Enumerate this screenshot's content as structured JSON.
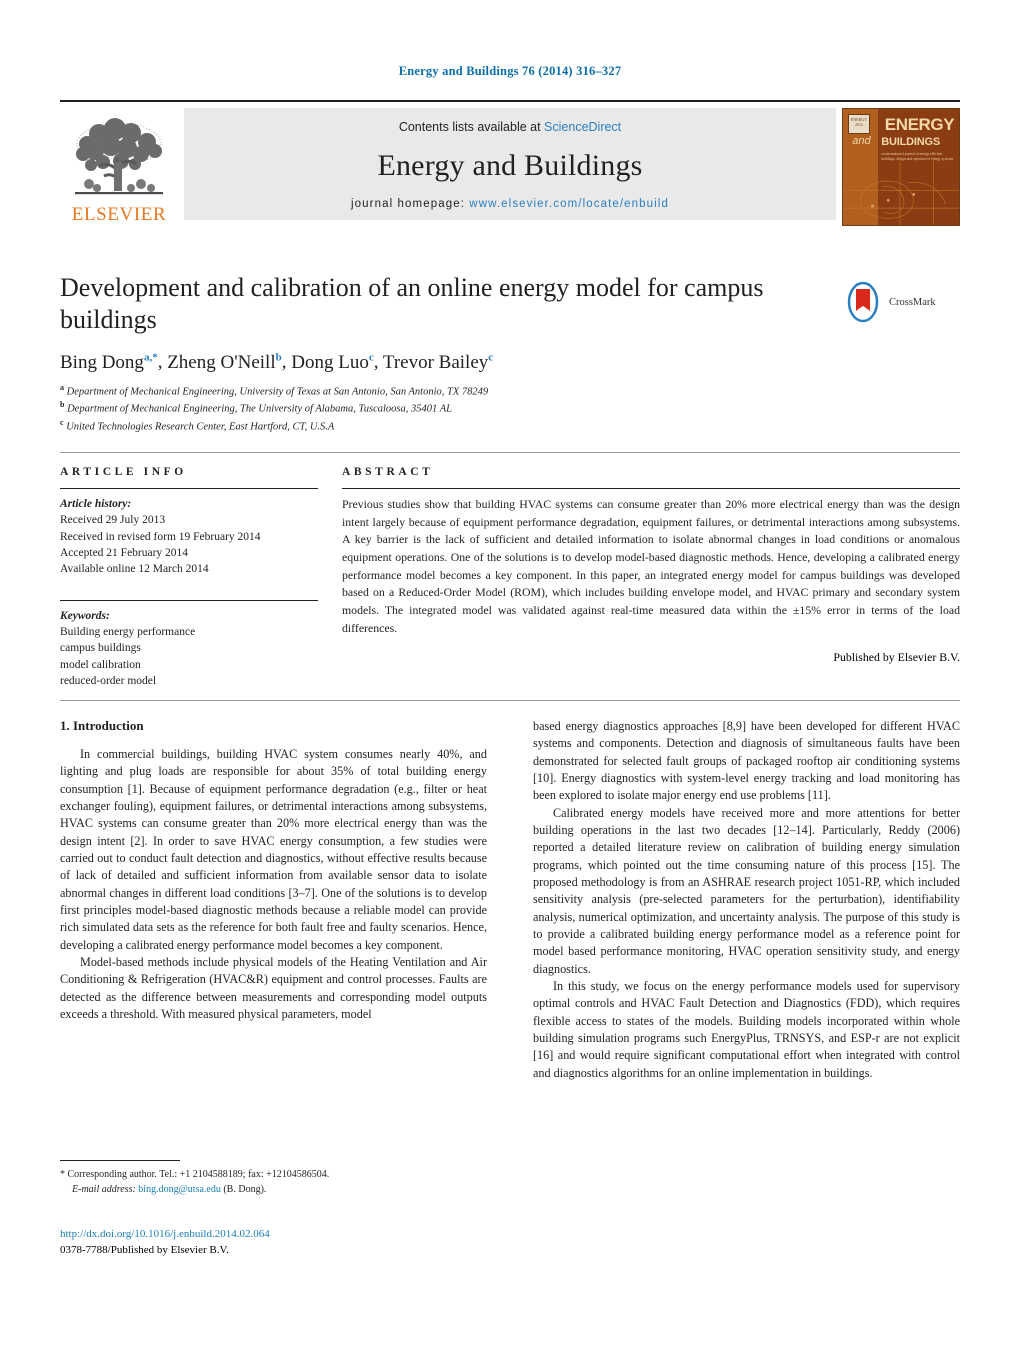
{
  "running_head": "Energy and Buildings 76 (2014) 316–327",
  "masthead": {
    "publisher_wordmark": "ELSEVIER",
    "contents_prefix": "Contents lists available at ",
    "contents_link": "ScienceDirect",
    "journal_name": "Energy and Buildings",
    "homepage_prefix": "journal homepage: ",
    "homepage_url": "www.elsevier.com/locate/enbuild",
    "cover": {
      "badge_text": "ENERGY 2012",
      "word_energy": "ENERGY",
      "word_and": "and",
      "word_buildings": "BUILDINGS",
      "subtitle": "an international journal of energy efficient buildings, design and operation of energy systems"
    }
  },
  "article": {
    "title": "Development and calibration of an online energy model for campus buildings",
    "crossmark_label": "CrossMark",
    "authors": [
      {
        "name": "Bing Dong",
        "marks": "a,*"
      },
      {
        "name": "Zheng O'Neill",
        "marks": "b"
      },
      {
        "name": "Dong Luo",
        "marks": "c"
      },
      {
        "name": "Trevor Bailey",
        "marks": "c"
      }
    ],
    "affiliations": [
      {
        "mark": "a",
        "text": "Department of Mechanical Engineering, University of Texas at San Antonio, San Antonio, TX 78249"
      },
      {
        "mark": "b",
        "text": "Department of Mechanical Engineering, The University of Alabama, Tuscaloosa, 35401 AL"
      },
      {
        "mark": "c",
        "text": "United Technologies Research Center, East Hartford, CT, U.S.A"
      }
    ]
  },
  "article_info": {
    "heading": "ARTICLE INFO",
    "history_label": "Article history:",
    "history": [
      "Received 29 July 2013",
      "Received in revised form 19 February 2014",
      "Accepted 21 February 2014",
      "Available online 12 March 2014"
    ],
    "keywords_label": "Keywords:",
    "keywords": [
      "Building energy performance",
      "campus buildings",
      "model calibration",
      "reduced-order model"
    ]
  },
  "abstract": {
    "heading": "ABSTRACT",
    "text": "Previous studies show that building HVAC systems can consume greater than 20% more electrical energy than was the design intent largely because of equipment performance degradation, equipment failures, or detrimental interactions among subsystems. A key barrier is the lack of sufficient and detailed information to isolate abnormal changes in load conditions or anomalous equipment operations. One of the solutions is to develop model-based diagnostic methods. Hence, developing a calibrated energy performance model becomes a key component. In this paper, an integrated energy model for campus buildings was developed based on a Reduced-Order Model (ROM), which includes building envelope model, and HVAC primary and secondary system models. The integrated model was validated against real-time measured data within the ±15% error in terms of the load differences.",
    "publisher_note": "Published by Elsevier B.V."
  },
  "body": {
    "section_number_title": "1. Introduction",
    "left_paragraphs": [
      "In commercial buildings, building HVAC system consumes nearly 40%, and lighting and plug loads are responsible for about 35% of total building energy consumption [1]. Because of equipment performance degradation (e.g., filter or heat exchanger fouling), equipment failures, or detrimental interactions among subsystems, HVAC systems can consume greater than 20% more electrical energy than was the design intent [2]. In order to save HVAC energy consumption, a few studies were carried out to conduct fault detection and diagnostics, without effective results because of lack of detailed and sufficient information from available sensor data to isolate abnormal changes in different load conditions [3–7]. One of the solutions is to develop first principles model-based diagnostic methods because a reliable model can provide rich simulated data sets as the reference for both fault free and faulty scenarios. Hence, developing a calibrated energy performance model becomes a key component.",
      "Model-based methods include physical models of the Heating Ventilation and Air Conditioning & Refrigeration (HVAC&R) equipment and control processes. Faults are detected as the difference between measurements and corresponding model outputs exceeds a threshold. With measured physical parameters, model"
    ],
    "right_paragraphs": [
      "based energy diagnostics approaches [8,9] have been developed for different HVAC systems and components. Detection and diagnosis of simultaneous faults have been demonstrated for selected fault groups of packaged rooftop air conditioning systems [10]. Energy diagnostics with system-level energy tracking and load monitoring has been explored to isolate major energy end use problems [11].",
      "Calibrated energy models have received more and more attentions for better building operations in the last two decades [12–14]. Particularly, Reddy (2006) reported a detailed literature review on calibration of building energy simulation programs, which pointed out the time consuming nature of this process [15]. The proposed methodology is from an ASHRAE research project 1051-RP, which included sensitivity analysis (pre-selected parameters for the perturbation), identifiability analysis, numerical optimization, and uncertainty analysis. The purpose of this study is to provide a calibrated building energy performance model as a reference point for model based performance monitoring, HVAC operation sensitivity study, and energy diagnostics.",
      "In this study, we focus on the energy performance models used for supervisory optimal controls and HVAC Fault Detection and Diagnostics (FDD), which requires flexible access to states of the models. Building models incorporated within whole building simulation programs such EnergyPlus, TRNSYS, and ESP-r are not explicit [16] and would require significant computational effort when integrated with control and diagnostics algorithms for an online implementation in buildings."
    ]
  },
  "footnotes": {
    "corresponding_marker": "*",
    "corresponding_text": "Corresponding author. Tel.: +1 2104588189; fax: +12104586504.",
    "email_label": "E-mail address:",
    "email": "bing.dong@utsa.edu",
    "email_suffix": "(B. Dong)."
  },
  "doi_block": {
    "doi_url": "http://dx.doi.org/10.1016/j.enbuild.2014.02.064",
    "issn_line": "0378-7788/Published by Elsevier B.V."
  },
  "colors": {
    "link_blue": "#1a7fb5",
    "header_blue": "#0b6ea8",
    "elsevier_orange": "#e87722",
    "band_gray": "#e9e9e9"
  }
}
